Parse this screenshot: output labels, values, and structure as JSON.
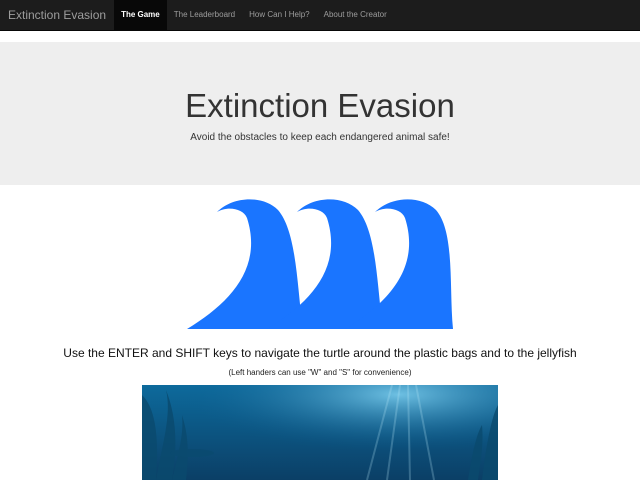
{
  "nav": {
    "brand": "Extinction Evasion",
    "items": [
      {
        "label": "The Game",
        "active": true
      },
      {
        "label": "The Leaderboard",
        "active": false
      },
      {
        "label": "How Can I Help?",
        "active": false
      },
      {
        "label": "About the Creator",
        "active": false
      }
    ]
  },
  "hero": {
    "title": "Extinction Evasion",
    "subtitle": "Avoid the obstacles to keep each endangered animal safe!"
  },
  "instructions": {
    "main": "Use the ENTER and SHIFT keys to navigate the turtle around the plastic bags and to the jellyfish",
    "note": "(Left handers can use \"W\" and \"S\" for convenience)"
  },
  "colors": {
    "wave": "#1a75ff",
    "navbar": "#1c1c1c",
    "hero_bg": "#eeeeee"
  },
  "icons": {
    "logo": "waves-logo-icon"
  }
}
